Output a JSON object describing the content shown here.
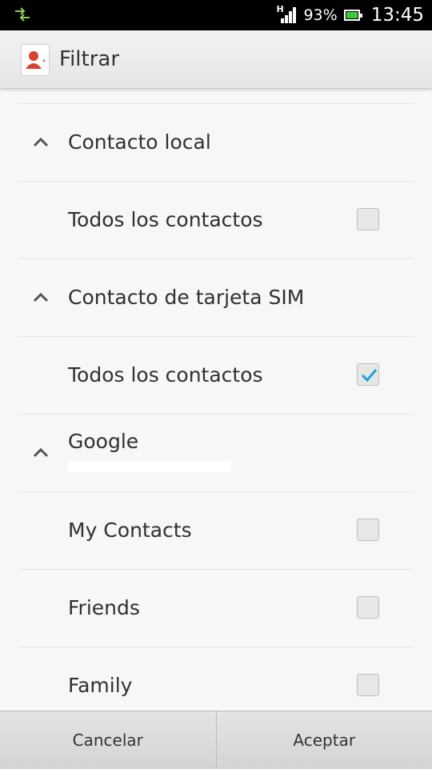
{
  "status_bar": {
    "network_type": "H",
    "battery_percent": "93%",
    "time": "13:45",
    "icons": [
      "data-sync-icon",
      "signal-icon",
      "battery-icon"
    ]
  },
  "header": {
    "title": "Filtrar",
    "icon": "contacts-icon"
  },
  "list": {
    "sections": [
      {
        "title": "Contacto local",
        "items": [
          {
            "label": "Todos los contactos",
            "checked": false
          }
        ]
      },
      {
        "title": "Contacto de tarjeta SIM",
        "items": [
          {
            "label": "Todos los contactos",
            "checked": true
          }
        ]
      },
      {
        "title": "Google",
        "items": [
          {
            "label": "My Contacts",
            "checked": false
          },
          {
            "label": "Friends",
            "checked": false
          },
          {
            "label": "Family",
            "checked": false
          }
        ]
      }
    ]
  },
  "footer": {
    "cancel_label": "Cancelar",
    "accept_label": "Aceptar"
  },
  "colors": {
    "check_accent": "#1aa6d1",
    "status_bar_bg": "#000000",
    "action_bar_bg": "#ececec",
    "battery_fill": "#3ec83e"
  }
}
